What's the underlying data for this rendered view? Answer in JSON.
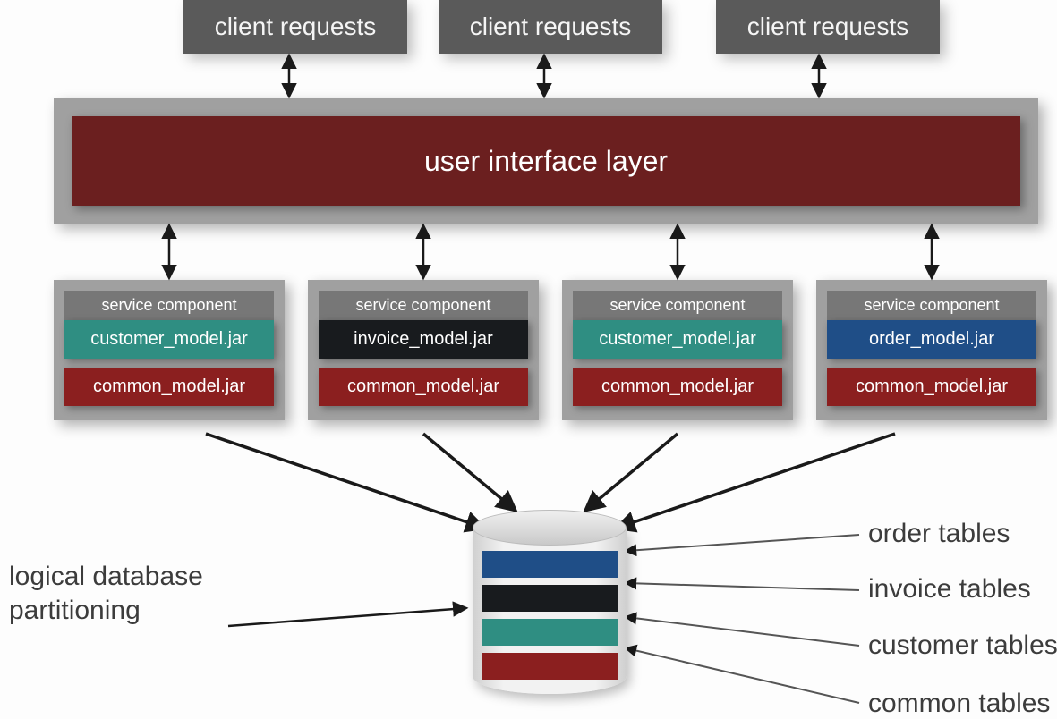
{
  "clients": [
    {
      "label": "client requests"
    },
    {
      "label": "client requests"
    },
    {
      "label": "client requests"
    }
  ],
  "ui_layer": {
    "label": "user interface layer"
  },
  "services": [
    {
      "header": "service component",
      "model": "customer_model.jar",
      "model_color": "teal",
      "common": "common_model.jar"
    },
    {
      "header": "service component",
      "model": "invoice_model.jar",
      "model_color": "black",
      "common": "common_model.jar"
    },
    {
      "header": "service component",
      "model": "customer_model.jar",
      "model_color": "teal",
      "common": "common_model.jar"
    },
    {
      "header": "service component",
      "model": "order_model.jar",
      "model_color": "blue",
      "common": "common_model.jar"
    }
  ],
  "db_labels": {
    "order": "order tables",
    "invoice": "invoice tables",
    "customer": "customer tables",
    "common": "common tables"
  },
  "partition_label": "logical database\npartitioning"
}
